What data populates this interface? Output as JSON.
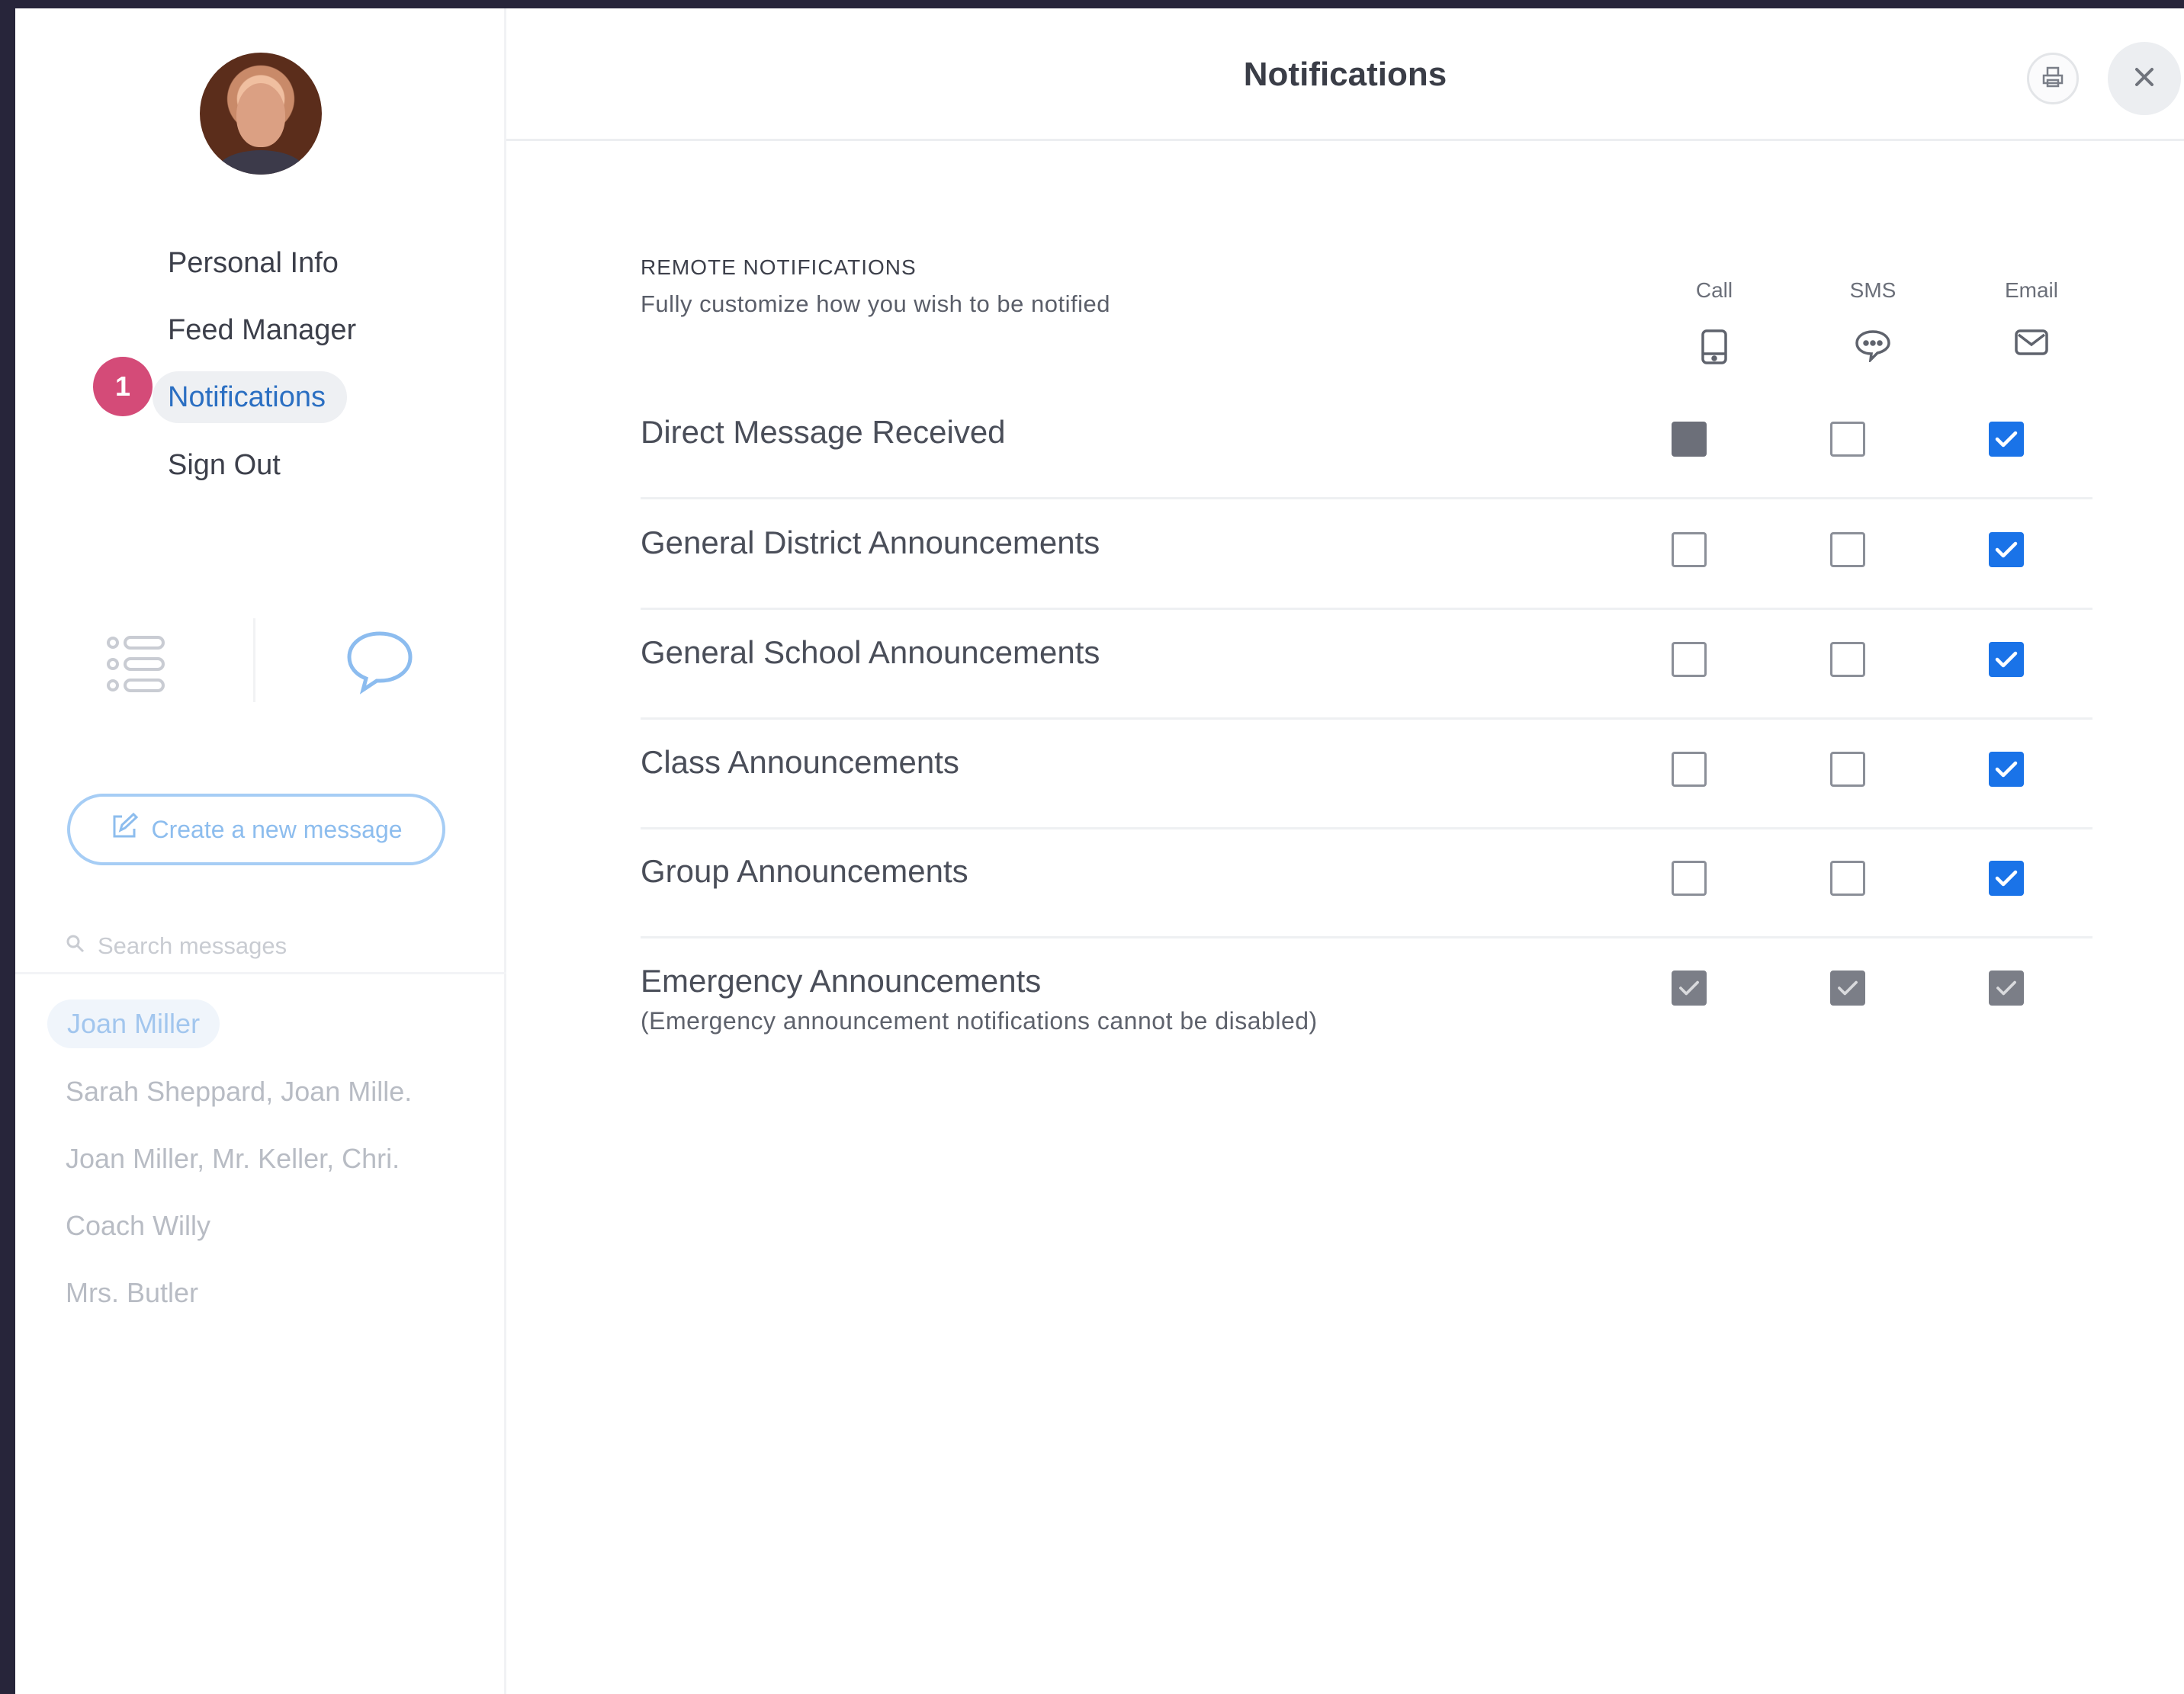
{
  "sidebar": {
    "nav": [
      {
        "label": "Personal Info"
      },
      {
        "label": "Feed Manager"
      },
      {
        "label": "Notifications"
      },
      {
        "label": "Sign Out"
      }
    ],
    "step_badge": "1",
    "create_button_label": "Create a new message",
    "search_placeholder": "Search messages",
    "conversations": [
      {
        "label": "Joan Miller"
      },
      {
        "label": "Sarah Sheppard, Joan Mille."
      },
      {
        "label": "Joan Miller, Mr. Keller, Chri."
      },
      {
        "label": "Coach Willy"
      },
      {
        "label": "Mrs. Butler"
      }
    ]
  },
  "header": {
    "title": "Notifications"
  },
  "section": {
    "title": "REMOTE NOTIFICATIONS",
    "subtitle": "Fully customize how you wish to be notified"
  },
  "columns": [
    {
      "label": "Call",
      "icon": "phone-icon"
    },
    {
      "label": "SMS",
      "icon": "sms-bubble-icon"
    },
    {
      "label": "Email",
      "icon": "envelope-icon"
    }
  ],
  "rows": [
    {
      "label": "Direct Message Received",
      "call": "filled",
      "sms": "unchecked",
      "email": "checked"
    },
    {
      "label": "General District Announcements",
      "call": "unchecked",
      "sms": "unchecked",
      "email": "checked"
    },
    {
      "label": "General School Announcements",
      "call": "unchecked",
      "sms": "unchecked",
      "email": "checked"
    },
    {
      "label": "Class Announcements",
      "call": "unchecked",
      "sms": "unchecked",
      "email": "checked"
    },
    {
      "label": "Group Announcements",
      "call": "unchecked",
      "sms": "unchecked",
      "email": "checked"
    },
    {
      "label": "Emergency Announcements",
      "note": "(Emergency announcement notifications cannot be disabled)",
      "call": "locked",
      "sms": "locked",
      "email": "locked"
    }
  ],
  "colors": {
    "accent": "#1a73e8",
    "active_nav": "#2b6fc2",
    "badge": "#d44b78",
    "locked_checkbox": "#7b7e87"
  }
}
